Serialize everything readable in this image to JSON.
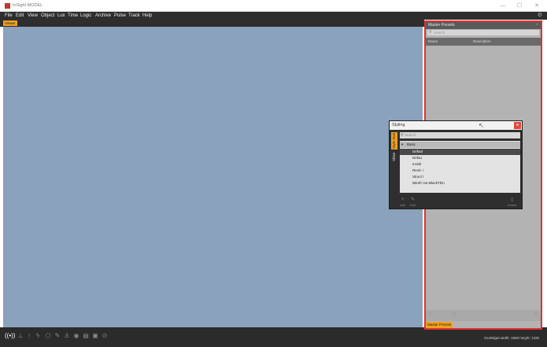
{
  "window": {
    "title": "InSight MODEL",
    "minimize": "—",
    "maximize": "☐",
    "close": "✕"
  },
  "menu": {
    "items": [
      "File",
      "Edit",
      "View",
      "Object",
      "Lux",
      "Time",
      "Logic",
      "Archive",
      "Pulse",
      "Track",
      "Help"
    ],
    "gear": "⚙"
  },
  "viewer": {
    "tab_label": "Viewer"
  },
  "bottom_toolbar": {
    "icons": [
      "broadcast-icon",
      "pin-icon",
      "move-icon",
      "lightning-icon",
      "cube-icon",
      "pencil-icon",
      "person-icon",
      "eye-icon",
      "layers-icon",
      "camera-icon",
      "settings-icon"
    ],
    "gl_info": "GLWidget  width: 1868    height: 1335"
  },
  "master_presets": {
    "title": "Master Presets",
    "search_placeholder": "Search",
    "columns": [
      "Name",
      "Description"
    ],
    "footer_buttons": [
      "Add",
      "Edit",
      "Delete"
    ],
    "tab_label": "Master Presets"
  },
  "styling_dialog": {
    "title": "Styling",
    "side_tabs": [
      "Style Sets",
      "Shine"
    ],
    "search_placeholder": "Search",
    "group_label": "Basic",
    "items": [
      "Defaul",
      "Defau",
      "Invisil",
      "Revit-  i",
      "Struct    l",
      "Wirefr   me-BlackThin"
    ],
    "selected_index": 0,
    "footer": {
      "add_label": "Add",
      "edit_label": "Edit",
      "delete_label": "Delete"
    }
  },
  "colors": {
    "accent": "#f0a020",
    "viewport": "#8aa2bb",
    "highlight_border": "#e03030",
    "dialog_close": "#e04a3a"
  }
}
